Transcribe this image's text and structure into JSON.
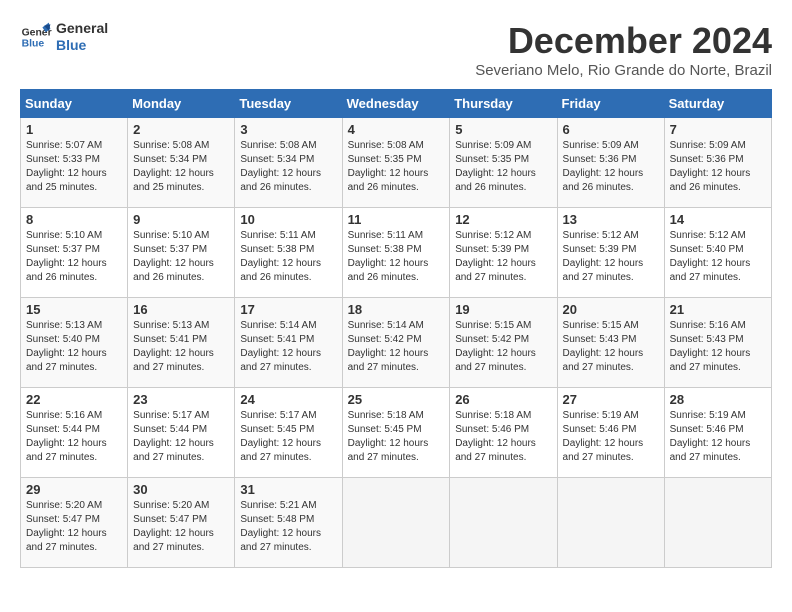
{
  "logo": {
    "line1": "General",
    "line2": "Blue"
  },
  "title": "December 2024",
  "location": "Severiano Melo, Rio Grande do Norte, Brazil",
  "weekdays": [
    "Sunday",
    "Monday",
    "Tuesday",
    "Wednesday",
    "Thursday",
    "Friday",
    "Saturday"
  ],
  "weeks": [
    [
      {
        "day": "1",
        "sunrise": "5:07 AM",
        "sunset": "5:33 PM",
        "daylight": "12 hours and 25 minutes."
      },
      {
        "day": "2",
        "sunrise": "5:08 AM",
        "sunset": "5:34 PM",
        "daylight": "12 hours and 25 minutes."
      },
      {
        "day": "3",
        "sunrise": "5:08 AM",
        "sunset": "5:34 PM",
        "daylight": "12 hours and 26 minutes."
      },
      {
        "day": "4",
        "sunrise": "5:08 AM",
        "sunset": "5:35 PM",
        "daylight": "12 hours and 26 minutes."
      },
      {
        "day": "5",
        "sunrise": "5:09 AM",
        "sunset": "5:35 PM",
        "daylight": "12 hours and 26 minutes."
      },
      {
        "day": "6",
        "sunrise": "5:09 AM",
        "sunset": "5:36 PM",
        "daylight": "12 hours and 26 minutes."
      },
      {
        "day": "7",
        "sunrise": "5:09 AM",
        "sunset": "5:36 PM",
        "daylight": "12 hours and 26 minutes."
      }
    ],
    [
      {
        "day": "8",
        "sunrise": "5:10 AM",
        "sunset": "5:37 PM",
        "daylight": "12 hours and 26 minutes."
      },
      {
        "day": "9",
        "sunrise": "5:10 AM",
        "sunset": "5:37 PM",
        "daylight": "12 hours and 26 minutes."
      },
      {
        "day": "10",
        "sunrise": "5:11 AM",
        "sunset": "5:38 PM",
        "daylight": "12 hours and 26 minutes."
      },
      {
        "day": "11",
        "sunrise": "5:11 AM",
        "sunset": "5:38 PM",
        "daylight": "12 hours and 26 minutes."
      },
      {
        "day": "12",
        "sunrise": "5:12 AM",
        "sunset": "5:39 PM",
        "daylight": "12 hours and 27 minutes."
      },
      {
        "day": "13",
        "sunrise": "5:12 AM",
        "sunset": "5:39 PM",
        "daylight": "12 hours and 27 minutes."
      },
      {
        "day": "14",
        "sunrise": "5:12 AM",
        "sunset": "5:40 PM",
        "daylight": "12 hours and 27 minutes."
      }
    ],
    [
      {
        "day": "15",
        "sunrise": "5:13 AM",
        "sunset": "5:40 PM",
        "daylight": "12 hours and 27 minutes."
      },
      {
        "day": "16",
        "sunrise": "5:13 AM",
        "sunset": "5:41 PM",
        "daylight": "12 hours and 27 minutes."
      },
      {
        "day": "17",
        "sunrise": "5:14 AM",
        "sunset": "5:41 PM",
        "daylight": "12 hours and 27 minutes."
      },
      {
        "day": "18",
        "sunrise": "5:14 AM",
        "sunset": "5:42 PM",
        "daylight": "12 hours and 27 minutes."
      },
      {
        "day": "19",
        "sunrise": "5:15 AM",
        "sunset": "5:42 PM",
        "daylight": "12 hours and 27 minutes."
      },
      {
        "day": "20",
        "sunrise": "5:15 AM",
        "sunset": "5:43 PM",
        "daylight": "12 hours and 27 minutes."
      },
      {
        "day": "21",
        "sunrise": "5:16 AM",
        "sunset": "5:43 PM",
        "daylight": "12 hours and 27 minutes."
      }
    ],
    [
      {
        "day": "22",
        "sunrise": "5:16 AM",
        "sunset": "5:44 PM",
        "daylight": "12 hours and 27 minutes."
      },
      {
        "day": "23",
        "sunrise": "5:17 AM",
        "sunset": "5:44 PM",
        "daylight": "12 hours and 27 minutes."
      },
      {
        "day": "24",
        "sunrise": "5:17 AM",
        "sunset": "5:45 PM",
        "daylight": "12 hours and 27 minutes."
      },
      {
        "day": "25",
        "sunrise": "5:18 AM",
        "sunset": "5:45 PM",
        "daylight": "12 hours and 27 minutes."
      },
      {
        "day": "26",
        "sunrise": "5:18 AM",
        "sunset": "5:46 PM",
        "daylight": "12 hours and 27 minutes."
      },
      {
        "day": "27",
        "sunrise": "5:19 AM",
        "sunset": "5:46 PM",
        "daylight": "12 hours and 27 minutes."
      },
      {
        "day": "28",
        "sunrise": "5:19 AM",
        "sunset": "5:46 PM",
        "daylight": "12 hours and 27 minutes."
      }
    ],
    [
      {
        "day": "29",
        "sunrise": "5:20 AM",
        "sunset": "5:47 PM",
        "daylight": "12 hours and 27 minutes."
      },
      {
        "day": "30",
        "sunrise": "5:20 AM",
        "sunset": "5:47 PM",
        "daylight": "12 hours and 27 minutes."
      },
      {
        "day": "31",
        "sunrise": "5:21 AM",
        "sunset": "5:48 PM",
        "daylight": "12 hours and 27 minutes."
      },
      null,
      null,
      null,
      null
    ]
  ]
}
